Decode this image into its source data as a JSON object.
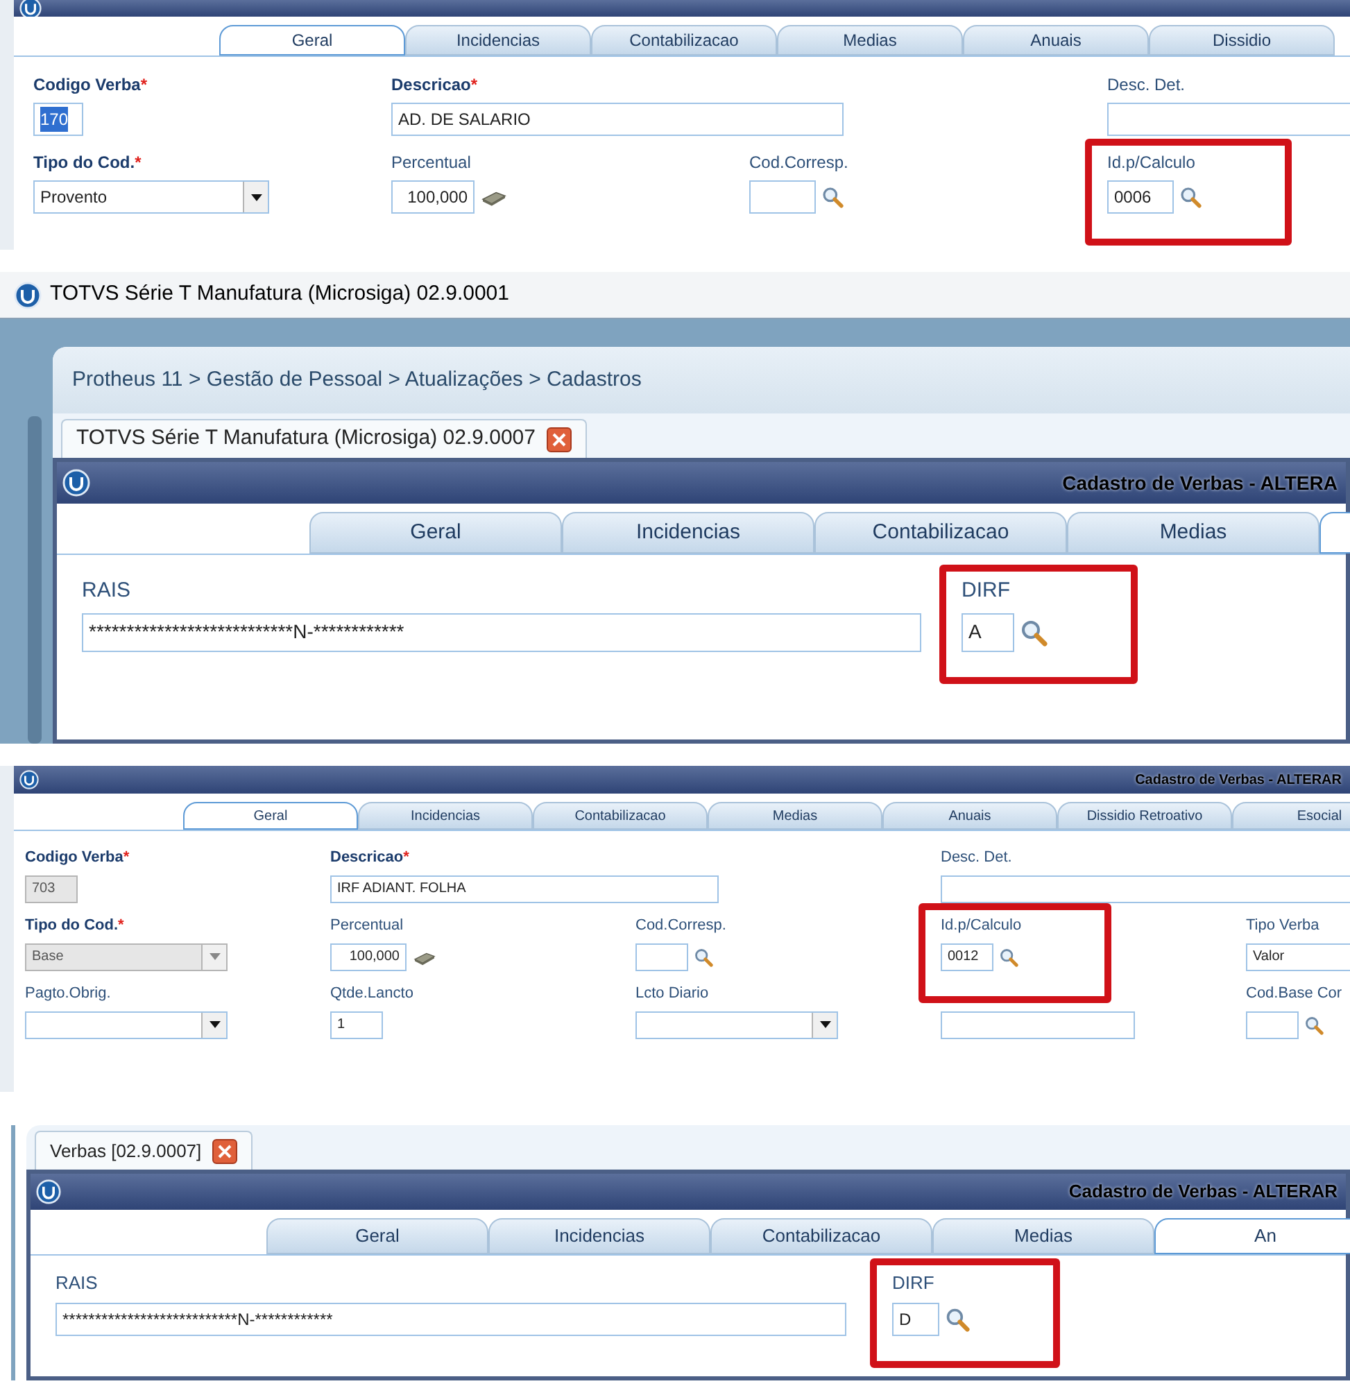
{
  "panels": [
    {
      "kind": "cadastro",
      "tabs": [
        {
          "label": "Geral",
          "selected": true
        },
        {
          "label": "Incidencias",
          "selected": false
        },
        {
          "label": "Contabilizacao",
          "selected": false
        },
        {
          "label": "Medias",
          "selected": false
        },
        {
          "label": "Anuais",
          "selected": false
        },
        {
          "label": "Dissidio",
          "selected": false
        }
      ],
      "rows": [
        [
          {
            "kind": "code",
            "label": "Codigo Verba",
            "required_mark": "*",
            "value": "170",
            "highlighted": true,
            "disabled": false,
            "marked": false
          },
          {
            "kind": "desc",
            "label": "Descricao",
            "required_mark": "*",
            "value": "AD. DE SALARIO",
            "disabled": false,
            "marked": false
          },
          "",
          {
            "kind": "detail",
            "label": "Desc. Det.",
            "disabled": false,
            "marked": false
          }
        ],
        [
          {
            "kind": "select",
            "label": "Tipo do Cod.",
            "required_mark": "*",
            "value": "Provento",
            "disabled": false,
            "marked": false
          },
          {
            "kind": "number",
            "label": "Percentual",
            "value": "100,000",
            "disabled": false,
            "marked": false
          },
          {
            "kind": "lookup",
            "label": "Cod.Corresp.",
            "disabled": false,
            "marked": false
          },
          {
            "kind": "lookup",
            "label": "Id.p/Calculo",
            "value": "0006",
            "disabled": false,
            "marked": true
          }
        ]
      ]
    },
    {
      "kind": "window",
      "app_title": "TOTVS Série T Manufatura (Microsiga) 02.9.0001",
      "breadcrumb": "Protheus 11 > Gestão de Pessoal > Atualizações > Cadastros",
      "doc_tab": "TOTVS Série T Manufatura (Microsiga) 02.9.0007",
      "title": "Cadastro de Verbas - ALTERA",
      "tabs": [
        {
          "label": "Geral",
          "selected": false
        },
        {
          "label": "Incidencias",
          "selected": false
        },
        {
          "label": "Contabilizacao",
          "selected": false
        },
        {
          "label": "Medias",
          "selected": false
        },
        {
          "selected": true
        }
      ],
      "rows": [
        [
          {
            "kind": "rais",
            "label": "RAIS",
            "value": "***************************N-************",
            "disabled": false,
            "marked": false
          },
          {
            "kind": "lookup",
            "label": "DIRF",
            "value": "A",
            "disabled": false,
            "marked": true
          }
        ]
      ]
    },
    {
      "kind": "cadastro",
      "title": "Cadastro de Verbas - ALTERAR",
      "tabs": [
        {
          "label": "Geral",
          "selected": true
        },
        {
          "label": "Incidencias",
          "selected": false
        },
        {
          "label": "Contabilizacao",
          "selected": false
        },
        {
          "label": "Medias",
          "selected": false
        },
        {
          "label": "Anuais",
          "selected": false
        },
        {
          "label": "Dissidio Retroativo",
          "selected": false
        },
        {
          "label": "Esocial",
          "selected": false
        }
      ],
      "rows": [
        [
          {
            "kind": "code",
            "label": "Codigo Verba",
            "required_mark": "*",
            "value": "703",
            "disabled": true,
            "marked": false
          },
          {
            "kind": "desc",
            "label": "Descricao",
            "required_mark": "*",
            "value": "IRF ADIANT. FOLHA",
            "disabled": false,
            "marked": false
          },
          "",
          {
            "kind": "detail",
            "label": "Desc. Det.",
            "disabled": false,
            "marked": false
          }
        ],
        [
          {
            "kind": "select",
            "label": "Tipo do Cod.",
            "required_mark": "*",
            "value": "Base",
            "disabled": true,
            "marked": false
          },
          {
            "kind": "number",
            "label": "Percentual",
            "value": "100,000",
            "disabled": false,
            "marked": false
          },
          {
            "kind": "lookup",
            "label": "Cod.Corresp.",
            "disabled": false,
            "marked": false
          },
          {
            "kind": "lookup",
            "label": "Id.p/Calculo",
            "value": "0012",
            "disabled": false,
            "marked": true
          },
          {
            "kind": "field",
            "label": "Tipo Verba",
            "value": "Valor",
            "disabled": false,
            "marked": false
          }
        ],
        [
          {
            "kind": "select",
            "label": "Pagto.Obrig.",
            "disabled": false,
            "marked": false
          },
          {
            "kind": "code",
            "label": "Qtde.Lancto",
            "value": "1",
            "disabled": false,
            "marked": false
          },
          {
            "kind": "select",
            "label": "Lcto Diario",
            "disabled": false,
            "marked": false
          },
          {
            "kind": "field",
            "disabled": false,
            "marked": false
          },
          {
            "kind": "lookup",
            "label": "Cod.Base Cor",
            "disabled": false,
            "marked": false
          }
        ]
      ]
    },
    {
      "kind": "window",
      "doc_tab": "Verbas [02.9.0007]",
      "title": "Cadastro de Verbas - ALTERAR",
      "tabs": [
        {
          "label": "Geral",
          "selected": false
        },
        {
          "label": "Incidencias",
          "selected": false
        },
        {
          "label": "Contabilizacao",
          "selected": false
        },
        {
          "label": "Medias",
          "selected": false
        },
        {
          "label": "An",
          "selected": true
        }
      ],
      "rows": [
        [
          {
            "kind": "rais",
            "label": "RAIS",
            "value": "***************************N-************",
            "disabled": false,
            "marked": false
          },
          {
            "kind": "lookup",
            "label": "DIRF",
            "value": "D",
            "disabled": false,
            "marked": true
          }
        ]
      ]
    }
  ]
}
